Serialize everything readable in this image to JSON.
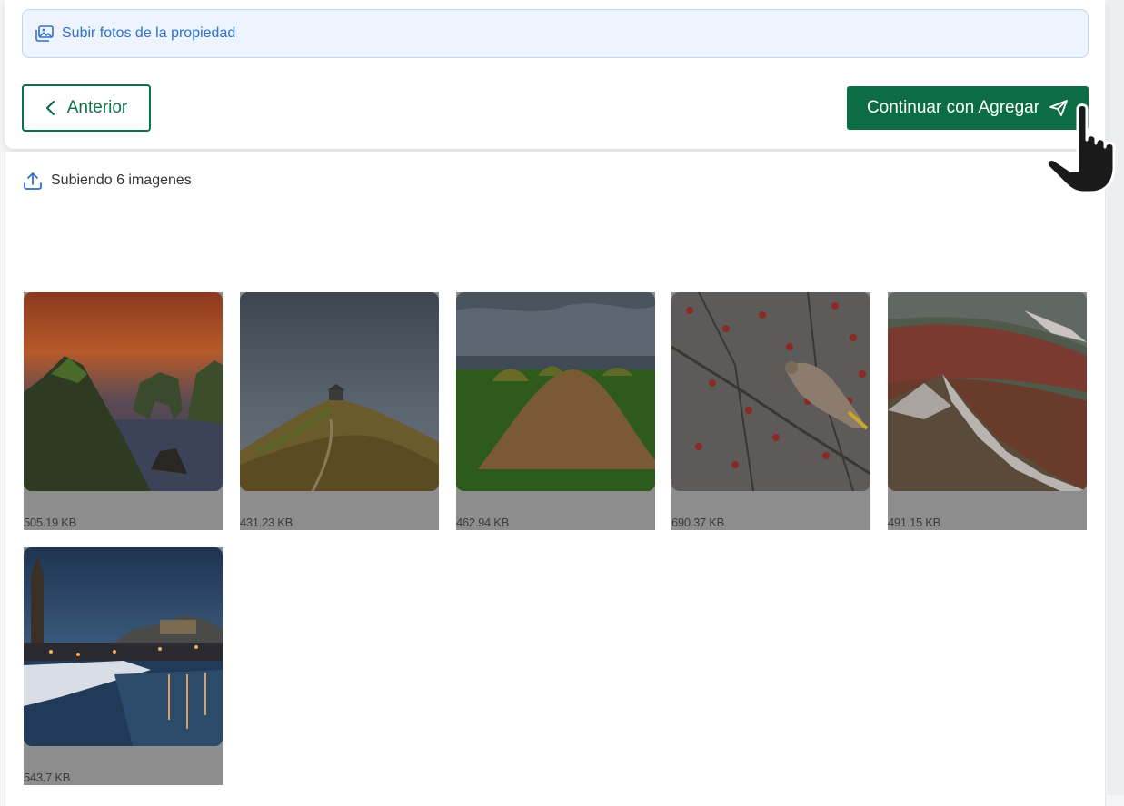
{
  "header": {
    "upload_link_label": "Subir fotos de la propiedad",
    "prev_button_label": "Anterior",
    "next_button_label": "Continuar con Agregar"
  },
  "uploads": {
    "status_text": "Subiendo 6 imagenes",
    "items": [
      {
        "size": "505.19 KB",
        "scene": "sea cliffs at sunset"
      },
      {
        "size": "431.23 KB",
        "scene": "hill with stone chapel"
      },
      {
        "size": "462.94 KB",
        "scene": "chocolate hills"
      },
      {
        "size": "690.37 KB",
        "scene": "waxwing bird on berry branch"
      },
      {
        "size": "491.15 KB",
        "scene": "rainbow mountains with snow"
      },
      {
        "size": "543.7 KB",
        "scene": "winter city at dusk by river"
      }
    ]
  },
  "colors": {
    "primary_green": "#0c6d45",
    "link_blue": "#2f6fd0",
    "overlay_gray": "#8d8d8d"
  }
}
